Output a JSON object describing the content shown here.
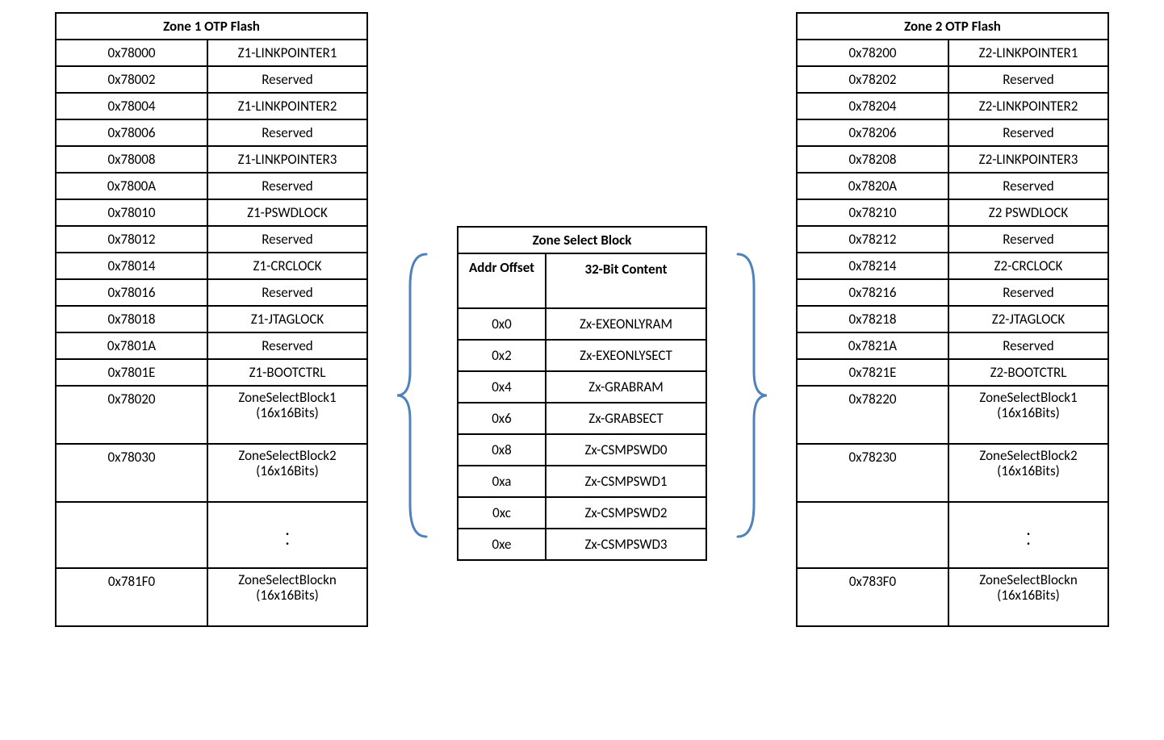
{
  "zone1": {
    "title": "Zone 1 OTP Flash",
    "rows": [
      {
        "addr": "0x78000",
        "desc": "Z1-LINKPOINTER1"
      },
      {
        "addr": "0x78002",
        "desc": "Reserved"
      },
      {
        "addr": "0x78004",
        "desc": "Z1-LINKPOINTER2"
      },
      {
        "addr": "0x78006",
        "desc": "Reserved"
      },
      {
        "addr": "0x78008",
        "desc": "Z1-LINKPOINTER3"
      },
      {
        "addr": "0x7800A",
        "desc": "Reserved"
      },
      {
        "addr": "0x78010",
        "desc": "Z1-PSWDLOCK"
      },
      {
        "addr": "0x78012",
        "desc": "Reserved"
      },
      {
        "addr": "0x78014",
        "desc": "Z1-CRCLOCK"
      },
      {
        "addr": "0x78016",
        "desc": "Reserved"
      },
      {
        "addr": "0x78018",
        "desc": "Z1-JTAGLOCK"
      },
      {
        "addr": "0x7801A",
        "desc": "Reserved"
      },
      {
        "addr": "0x7801E",
        "desc": "Z1-BOOTCTRL"
      },
      {
        "addr": "0x78020",
        "descA": "ZoneSelectBlock1",
        "descB": "(16x16Bits)",
        "tall": true
      },
      {
        "addr": "0x78030",
        "descA": "ZoneSelectBlock2",
        "descB": "(16x16Bits)",
        "tall": true
      },
      {
        "addr": "",
        "dots": true
      },
      {
        "addr": "0x781F0",
        "descA": "ZoneSelectBlockn",
        "descB": "(16x16Bits)",
        "tall": true
      }
    ]
  },
  "zone2": {
    "title": "Zone 2 OTP Flash",
    "rows": [
      {
        "addr": "0x78200",
        "desc": "Z2-LINKPOINTER1"
      },
      {
        "addr": "0x78202",
        "desc": "Reserved"
      },
      {
        "addr": "0x78204",
        "desc": "Z2-LINKPOINTER2"
      },
      {
        "addr": "0x78206",
        "desc": "Reserved"
      },
      {
        "addr": "0x78208",
        "desc": "Z2-LINKPOINTER3"
      },
      {
        "addr": "0x7820A",
        "desc": "Reserved"
      },
      {
        "addr": "0x78210",
        "desc": "Z2 PSWDLOCK"
      },
      {
        "addr": "0x78212",
        "desc": "Reserved"
      },
      {
        "addr": "0x78214",
        "desc": "Z2-CRCLOCK"
      },
      {
        "addr": "0x78216",
        "desc": "Reserved"
      },
      {
        "addr": "0x78218",
        "desc": "Z2-JTAGLOCK"
      },
      {
        "addr": "0x7821A",
        "desc": "Reserved"
      },
      {
        "addr": "0x7821E",
        "desc": "Z2-BOOTCTRL"
      },
      {
        "addr": "0x78220",
        "descA": "ZoneSelectBlock1",
        "descB": "(16x16Bits)",
        "tall": true
      },
      {
        "addr": "0x78230",
        "descA": "ZoneSelectBlock2",
        "descB": "(16x16Bits)",
        "tall": true
      },
      {
        "addr": "",
        "dots": true
      },
      {
        "addr": "0x783F0",
        "descA": "ZoneSelectBlockn",
        "descB": "(16x16Bits)",
        "tall": true
      }
    ]
  },
  "zsb": {
    "title": "Zone Select Block",
    "sub_off": "Addr Offset",
    "sub_content": "32-Bit Content",
    "rows": [
      {
        "off": "0x0",
        "content": "Zx-EXEONLYRAM"
      },
      {
        "off": "0x2",
        "content": "Zx-EXEONLYSECT"
      },
      {
        "off": "0x4",
        "content": "Zx-GRABRAM"
      },
      {
        "off": "0x6",
        "content": "Zx-GRABSECT"
      },
      {
        "off": "0x8",
        "content": "Zx-CSMPSWD0"
      },
      {
        "off": "0xa",
        "content": "Zx-CSMPSWD1"
      },
      {
        "off": "0xc",
        "content": "Zx-CSMPSWD2"
      },
      {
        "off": "0xe",
        "content": "Zx-CSMPSWD3"
      }
    ]
  },
  "brace_color": "#4f81bd",
  "dots_glyph": ".\n."
}
